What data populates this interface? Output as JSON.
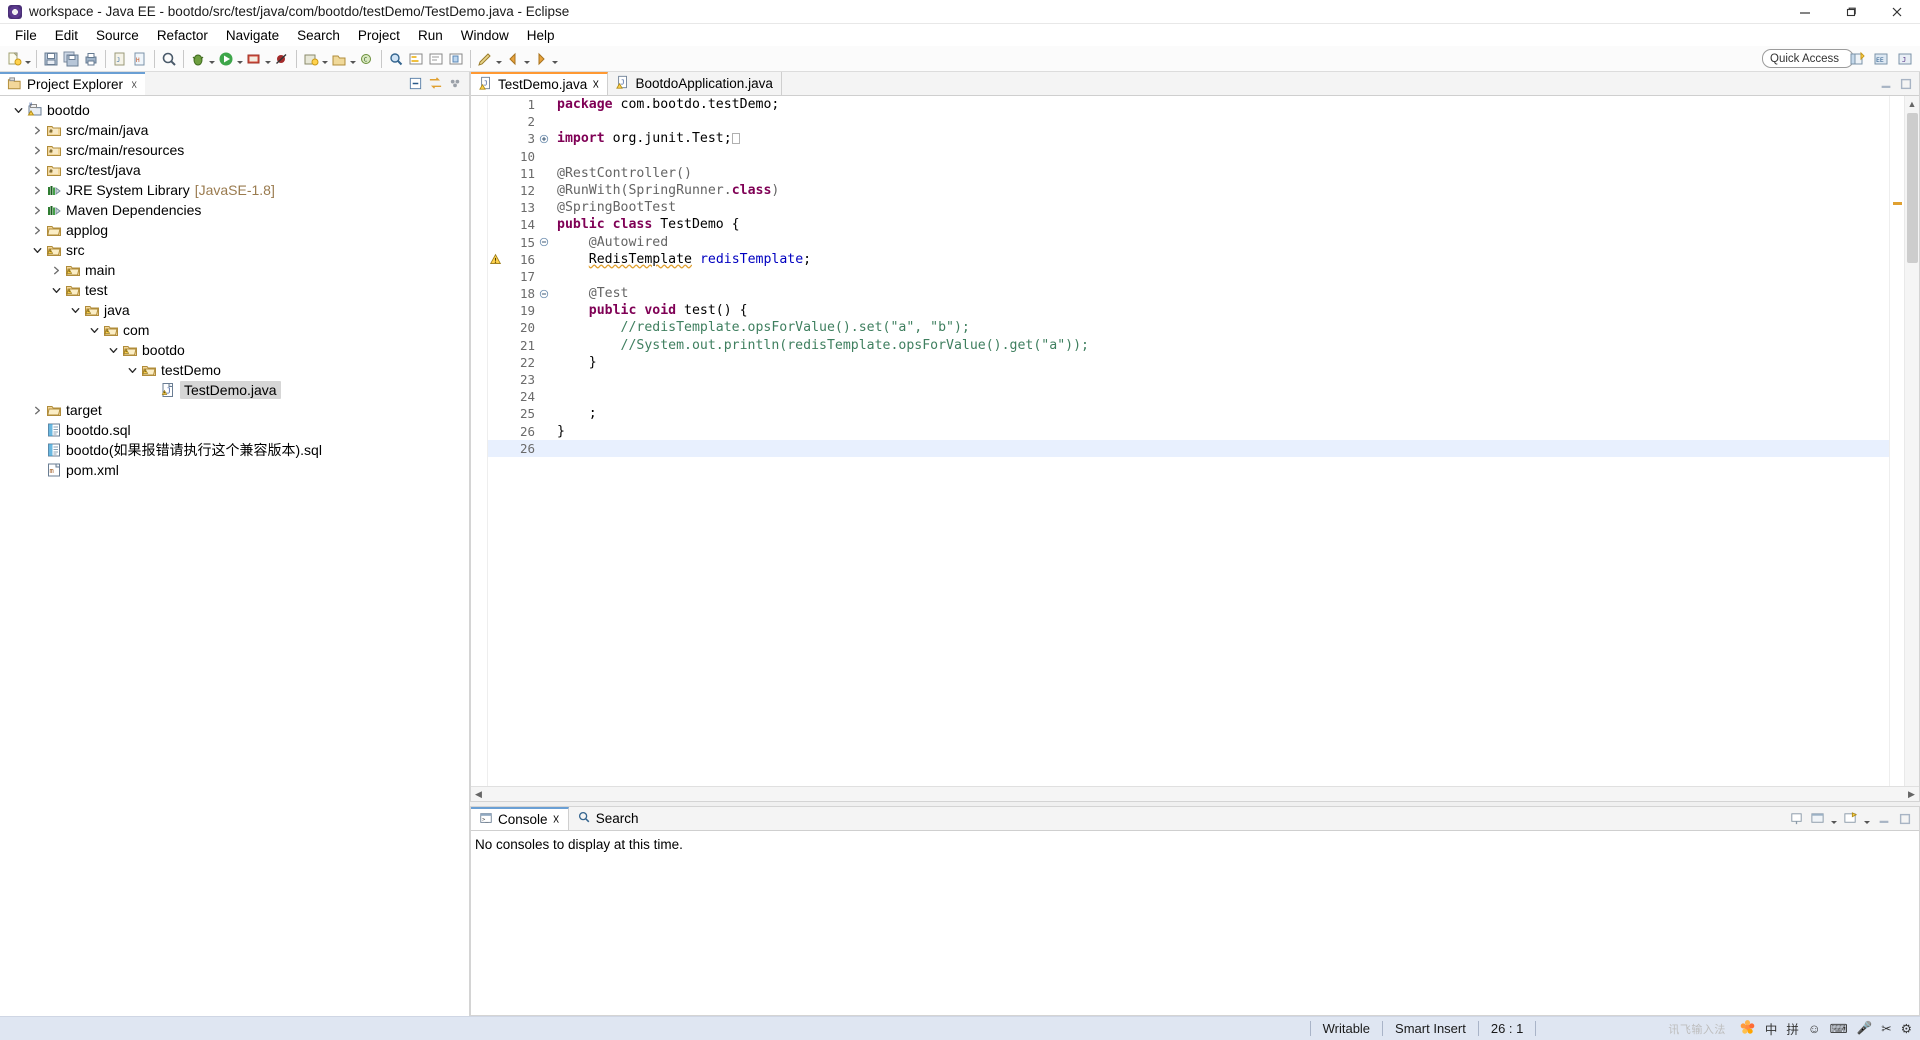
{
  "window": {
    "title": "workspace - Java EE - bootdo/src/test/java/com/bootdo/testDemo/TestDemo.java - Eclipse",
    "minimize_label": "Minimize",
    "maximize_label": "Restore",
    "close_label": "Close"
  },
  "menubar": {
    "items": [
      {
        "label": "File",
        "mnemonic": "F"
      },
      {
        "label": "Edit",
        "mnemonic": "E"
      },
      {
        "label": "Source",
        "mnemonic": "S"
      },
      {
        "label": "Refactor",
        "mnemonic": "t"
      },
      {
        "label": "Navigate",
        "mnemonic": "N"
      },
      {
        "label": "Search",
        "mnemonic": "a"
      },
      {
        "label": "Project",
        "mnemonic": "P"
      },
      {
        "label": "Run",
        "mnemonic": "R"
      },
      {
        "label": "Window",
        "mnemonic": "W"
      },
      {
        "label": "Help",
        "mnemonic": "H"
      }
    ]
  },
  "toolbar": {
    "quick_access_placeholder": "Quick Access",
    "buttons": [
      "new-wizard-icon",
      "new-dropdown-icon",
      "save-icon",
      "save-all-icon",
      "print-icon",
      "new-jsp-icon",
      "new-html-icon",
      "open-type-icon",
      "debug-icon",
      "run-icon",
      "run-dropdown-icon",
      "coverage-icon",
      "external-tools-icon",
      "skip-breakpoints-icon",
      "new-java-project-icon",
      "new-package-icon",
      "new-class-icon",
      "new-interface-icon",
      "open-resource-icon",
      "search-icon",
      "toggle-markoccurrences-icon",
      "show-whitespace-icon",
      "previous-annotation-icon",
      "next-annotation-icon",
      "last-edit-location-icon",
      "back-icon",
      "forward-icon"
    ],
    "perspective_buttons": [
      "open-perspective-icon",
      "java-ee-perspective-icon",
      "java-perspective-icon"
    ]
  },
  "explorer": {
    "tab_title": "Project Explorer",
    "tab_icon": "project-explorer-icon",
    "tools": [
      "collapse-all-icon",
      "link-with-editor-icon",
      "view-menu-icon"
    ],
    "tree": [
      {
        "label": "bootdo",
        "indent": 0,
        "icon": "maven-project-icon",
        "twisty": "expanded",
        "selected": false
      },
      {
        "label": "src/main/java",
        "indent": 1,
        "icon": "source-folder-icon",
        "twisty": "collapsed",
        "selected": false
      },
      {
        "label": "src/main/resources",
        "indent": 1,
        "icon": "source-folder-icon",
        "twisty": "collapsed",
        "selected": false
      },
      {
        "label": "src/test/java",
        "indent": 1,
        "icon": "source-folder-icon",
        "twisty": "collapsed",
        "selected": false
      },
      {
        "label": "JRE System Library",
        "suffix": "[JavaSE-1.8]",
        "indent": 1,
        "icon": "library-icon",
        "twisty": "collapsed",
        "selected": false
      },
      {
        "label": "Maven Dependencies",
        "indent": 1,
        "icon": "library-icon",
        "twisty": "collapsed",
        "selected": false
      },
      {
        "label": "applog",
        "indent": 1,
        "icon": "folder-icon",
        "twisty": "collapsed",
        "selected": false
      },
      {
        "label": "src",
        "indent": 1,
        "icon": "folder-warning-icon",
        "twisty": "expanded",
        "selected": false
      },
      {
        "label": "main",
        "indent": 2,
        "icon": "folder-warning-icon",
        "twisty": "collapsed",
        "selected": false
      },
      {
        "label": "test",
        "indent": 2,
        "icon": "folder-warning-icon",
        "twisty": "expanded",
        "selected": false
      },
      {
        "label": "java",
        "indent": 3,
        "icon": "folder-warning-icon",
        "twisty": "expanded",
        "selected": false
      },
      {
        "label": "com",
        "indent": 4,
        "icon": "folder-warning-icon",
        "twisty": "expanded",
        "selected": false
      },
      {
        "label": "bootdo",
        "indent": 5,
        "icon": "folder-warning-icon",
        "twisty": "expanded",
        "selected": false
      },
      {
        "label": "testDemo",
        "indent": 6,
        "icon": "folder-warning-icon",
        "twisty": "expanded",
        "selected": false
      },
      {
        "label": "TestDemo.java",
        "indent": 7,
        "icon": "java-file-warning-icon",
        "twisty": "none",
        "selected": true
      },
      {
        "label": "target",
        "indent": 1,
        "icon": "folder-icon",
        "twisty": "collapsed",
        "selected": false
      },
      {
        "label": "bootdo.sql",
        "indent": 1,
        "icon": "sql-file-icon",
        "twisty": "none",
        "selected": false
      },
      {
        "label": "bootdo(如果报错请执行这个兼容版本).sql",
        "indent": 1,
        "icon": "sql-file-icon",
        "twisty": "none",
        "selected": false
      },
      {
        "label": "pom.xml",
        "indent": 1,
        "icon": "maven-pom-icon",
        "twisty": "none",
        "selected": false
      }
    ]
  },
  "editor": {
    "tabs": [
      {
        "label": "TestDemo.java",
        "icon": "java-file-warning-icon",
        "active": true,
        "closable": true
      },
      {
        "label": "BootdoApplication.java",
        "icon": "java-file-warning-icon",
        "active": false,
        "closable": false
      }
    ],
    "lines": [
      {
        "num": "1",
        "fold": "",
        "marker": "",
        "cursor": false,
        "tokens": [
          {
            "t": "package ",
            "c": "kw"
          },
          {
            "t": "com.bootdo.testDemo;",
            "c": ""
          }
        ]
      },
      {
        "num": "2",
        "fold": "",
        "marker": "",
        "cursor": false,
        "tokens": []
      },
      {
        "num": "3",
        "fold": "plus",
        "marker": "",
        "cursor": false,
        "tokens": [
          {
            "t": "import ",
            "c": "kw"
          },
          {
            "t": "org.junit.Test;",
            "c": ""
          },
          {
            "t": "▫",
            "c": "boxed"
          }
        ]
      },
      {
        "num": "10",
        "fold": "",
        "marker": "",
        "cursor": false,
        "tokens": []
      },
      {
        "num": "11",
        "fold": "",
        "marker": "",
        "cursor": false,
        "tokens": [
          {
            "t": "@RestController()",
            "c": "ann"
          }
        ]
      },
      {
        "num": "12",
        "fold": "",
        "marker": "",
        "cursor": false,
        "tokens": [
          {
            "t": "@RunWith(",
            "c": "ann"
          },
          {
            "t": "SpringRunner.",
            "c": "ann"
          },
          {
            "t": "class",
            "c": "kw"
          },
          {
            "t": ")",
            "c": "ann"
          }
        ]
      },
      {
        "num": "13",
        "fold": "",
        "marker": "",
        "cursor": false,
        "tokens": [
          {
            "t": "@SpringBootTest",
            "c": "ann"
          }
        ]
      },
      {
        "num": "14",
        "fold": "",
        "marker": "",
        "cursor": false,
        "tokens": [
          {
            "t": "public class ",
            "c": "kw"
          },
          {
            "t": "TestDemo {",
            "c": ""
          }
        ]
      },
      {
        "num": "15",
        "fold": "minus",
        "marker": "",
        "cursor": false,
        "tokens": [
          {
            "t": "    @Autowired",
            "c": "ann"
          }
        ]
      },
      {
        "num": "16",
        "fold": "",
        "marker": "warning",
        "cursor": false,
        "tokens": [
          {
            "t": "    ",
            "c": ""
          },
          {
            "t": "RedisTemplate",
            "c": "warnu"
          },
          {
            "t": " ",
            "c": ""
          },
          {
            "t": "redisTemplate",
            "c": "fld"
          },
          {
            "t": ";",
            "c": ""
          }
        ]
      },
      {
        "num": "17",
        "fold": "",
        "marker": "",
        "cursor": false,
        "tokens": []
      },
      {
        "num": "18",
        "fold": "minus",
        "marker": "",
        "cursor": false,
        "tokens": [
          {
            "t": "    @Test",
            "c": "ann"
          }
        ]
      },
      {
        "num": "19",
        "fold": "",
        "marker": "",
        "cursor": false,
        "tokens": [
          {
            "t": "    ",
            "c": ""
          },
          {
            "t": "public void ",
            "c": "kw"
          },
          {
            "t": "test() {",
            "c": ""
          }
        ]
      },
      {
        "num": "20",
        "fold": "",
        "marker": "",
        "cursor": false,
        "tokens": [
          {
            "t": "        //redisTemplate.opsForValue().set(\"a\", \"b\");",
            "c": "cm"
          }
        ]
      },
      {
        "num": "21",
        "fold": "",
        "marker": "",
        "cursor": false,
        "tokens": [
          {
            "t": "        //System.out.println(redisTemplate.opsForValue().get(\"a\"));",
            "c": "cm"
          }
        ]
      },
      {
        "num": "22",
        "fold": "",
        "marker": "",
        "cursor": false,
        "tokens": [
          {
            "t": "    }",
            "c": ""
          }
        ]
      },
      {
        "num": "23",
        "fold": "",
        "marker": "",
        "cursor": false,
        "tokens": []
      },
      {
        "num": "24",
        "fold": "",
        "marker": "",
        "cursor": false,
        "tokens": []
      },
      {
        "num": "25",
        "fold": "",
        "marker": "",
        "cursor": false,
        "tokens": [
          {
            "t": "    ;",
            "c": ""
          }
        ]
      },
      {
        "num": "26",
        "fold": "",
        "marker": "",
        "cursor": false,
        "tokens": [
          {
            "t": "}",
            "c": ""
          }
        ]
      },
      {
        "num": "26",
        "fold": "",
        "marker": "",
        "cursor": true,
        "tokens": []
      }
    ]
  },
  "console": {
    "tabs": [
      {
        "label": "Console",
        "icon": "console-icon",
        "active": true,
        "closable": true
      },
      {
        "label": "Search",
        "icon": "search-icon",
        "active": false,
        "closable": false
      }
    ],
    "message": "No consoles to display at this time.",
    "tools": [
      "pin-console-icon",
      "display-selected-console-icon",
      "open-console-icon",
      "minimize-icon",
      "maximize-icon"
    ]
  },
  "statusbar": {
    "writable": "Writable",
    "insert_mode": "Smart Insert",
    "position": "26 : 1"
  },
  "ime": {
    "logo": "讯飞输入法",
    "items": [
      "中",
      "拼",
      "☺",
      "⌨",
      "🎤",
      "✂",
      "⚙"
    ]
  },
  "colors": {
    "accent_blue": "#6a9fd4",
    "active_tab_orange": "#ff9933",
    "status_bg": "#dfe6f2",
    "keyword": "#7f0055",
    "comment": "#3f7f5f",
    "string": "#2a00ff",
    "field": "#0000c0",
    "annotation": "#646464"
  }
}
